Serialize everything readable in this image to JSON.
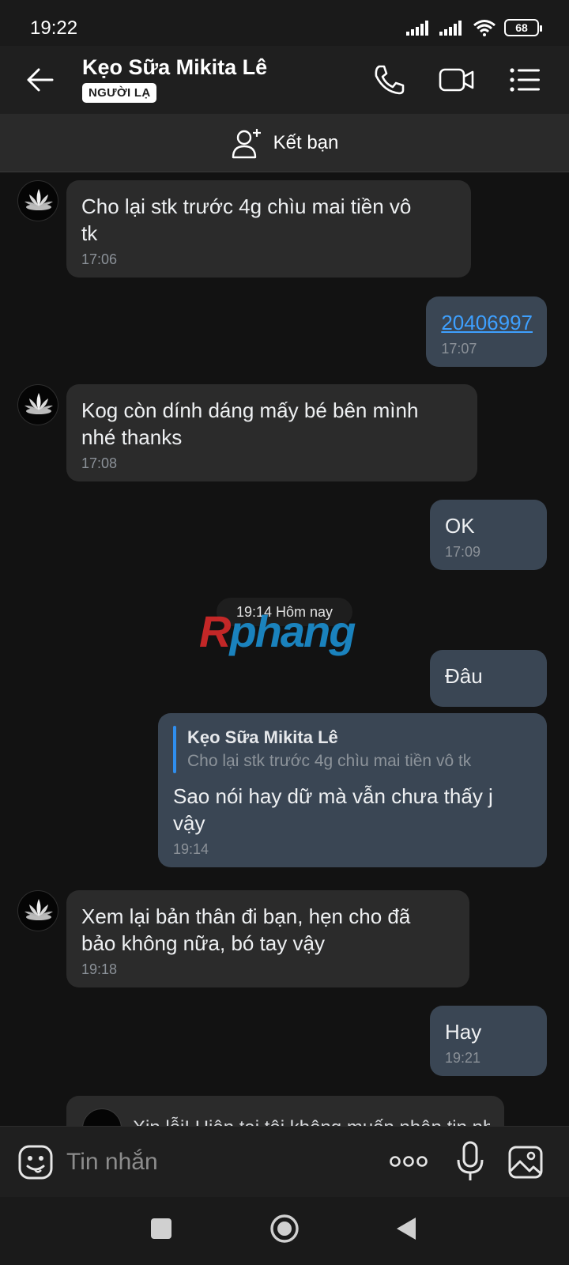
{
  "status": {
    "time": "19:22",
    "battery": "68"
  },
  "header": {
    "name": "Kẹo Sữa Mikita Lê",
    "badge": "NGƯỜI LẠ"
  },
  "add_friend": {
    "label": "Kết bạn"
  },
  "messages": [
    {
      "dir": "in",
      "text": "Cho lại stk trước 4g chìu mai tiền vô\ntk",
      "time": "17:06"
    },
    {
      "dir": "out",
      "text": "20406997",
      "time": "17:07"
    },
    {
      "dir": "in",
      "text": "Kog còn dính dáng mấy bé bên mình\nnhé thanks",
      "time": "17:08"
    },
    {
      "dir": "out",
      "text": "OK",
      "time": "17:09"
    },
    {
      "dir": "out",
      "text": "Đâu"
    },
    {
      "dir": "out",
      "reply_name": "Kẹo Sữa Mikita Lê",
      "reply_text": "Cho lại stk trước 4g chìu mai tiền vô tk",
      "text": "Sao nói hay dữ mà vẫn chưa thấy j\nvậy",
      "time": "19:14"
    },
    {
      "dir": "in",
      "text": "Xem lại bản thân đi bạn, hẹn cho đã\nbảo không nữa, bó tay vậy",
      "time": "19:18"
    },
    {
      "dir": "out",
      "text": "Hay",
      "time": "19:21"
    },
    {
      "dir": "in",
      "text": "Xin lỗi! Hiện tại tôi không muốn nhận tin nhắn"
    }
  ],
  "day_divider": "19:14 Hôm nay",
  "watermark": {
    "r": "R",
    "rest": "phang"
  },
  "composer": {
    "placeholder": "Tin nhắn"
  },
  "colors": {
    "incoming_bubble": "#2b2b2b",
    "outgoing_bubble": "#3a4654",
    "link": "#3ea0ff",
    "background": "#121212"
  }
}
